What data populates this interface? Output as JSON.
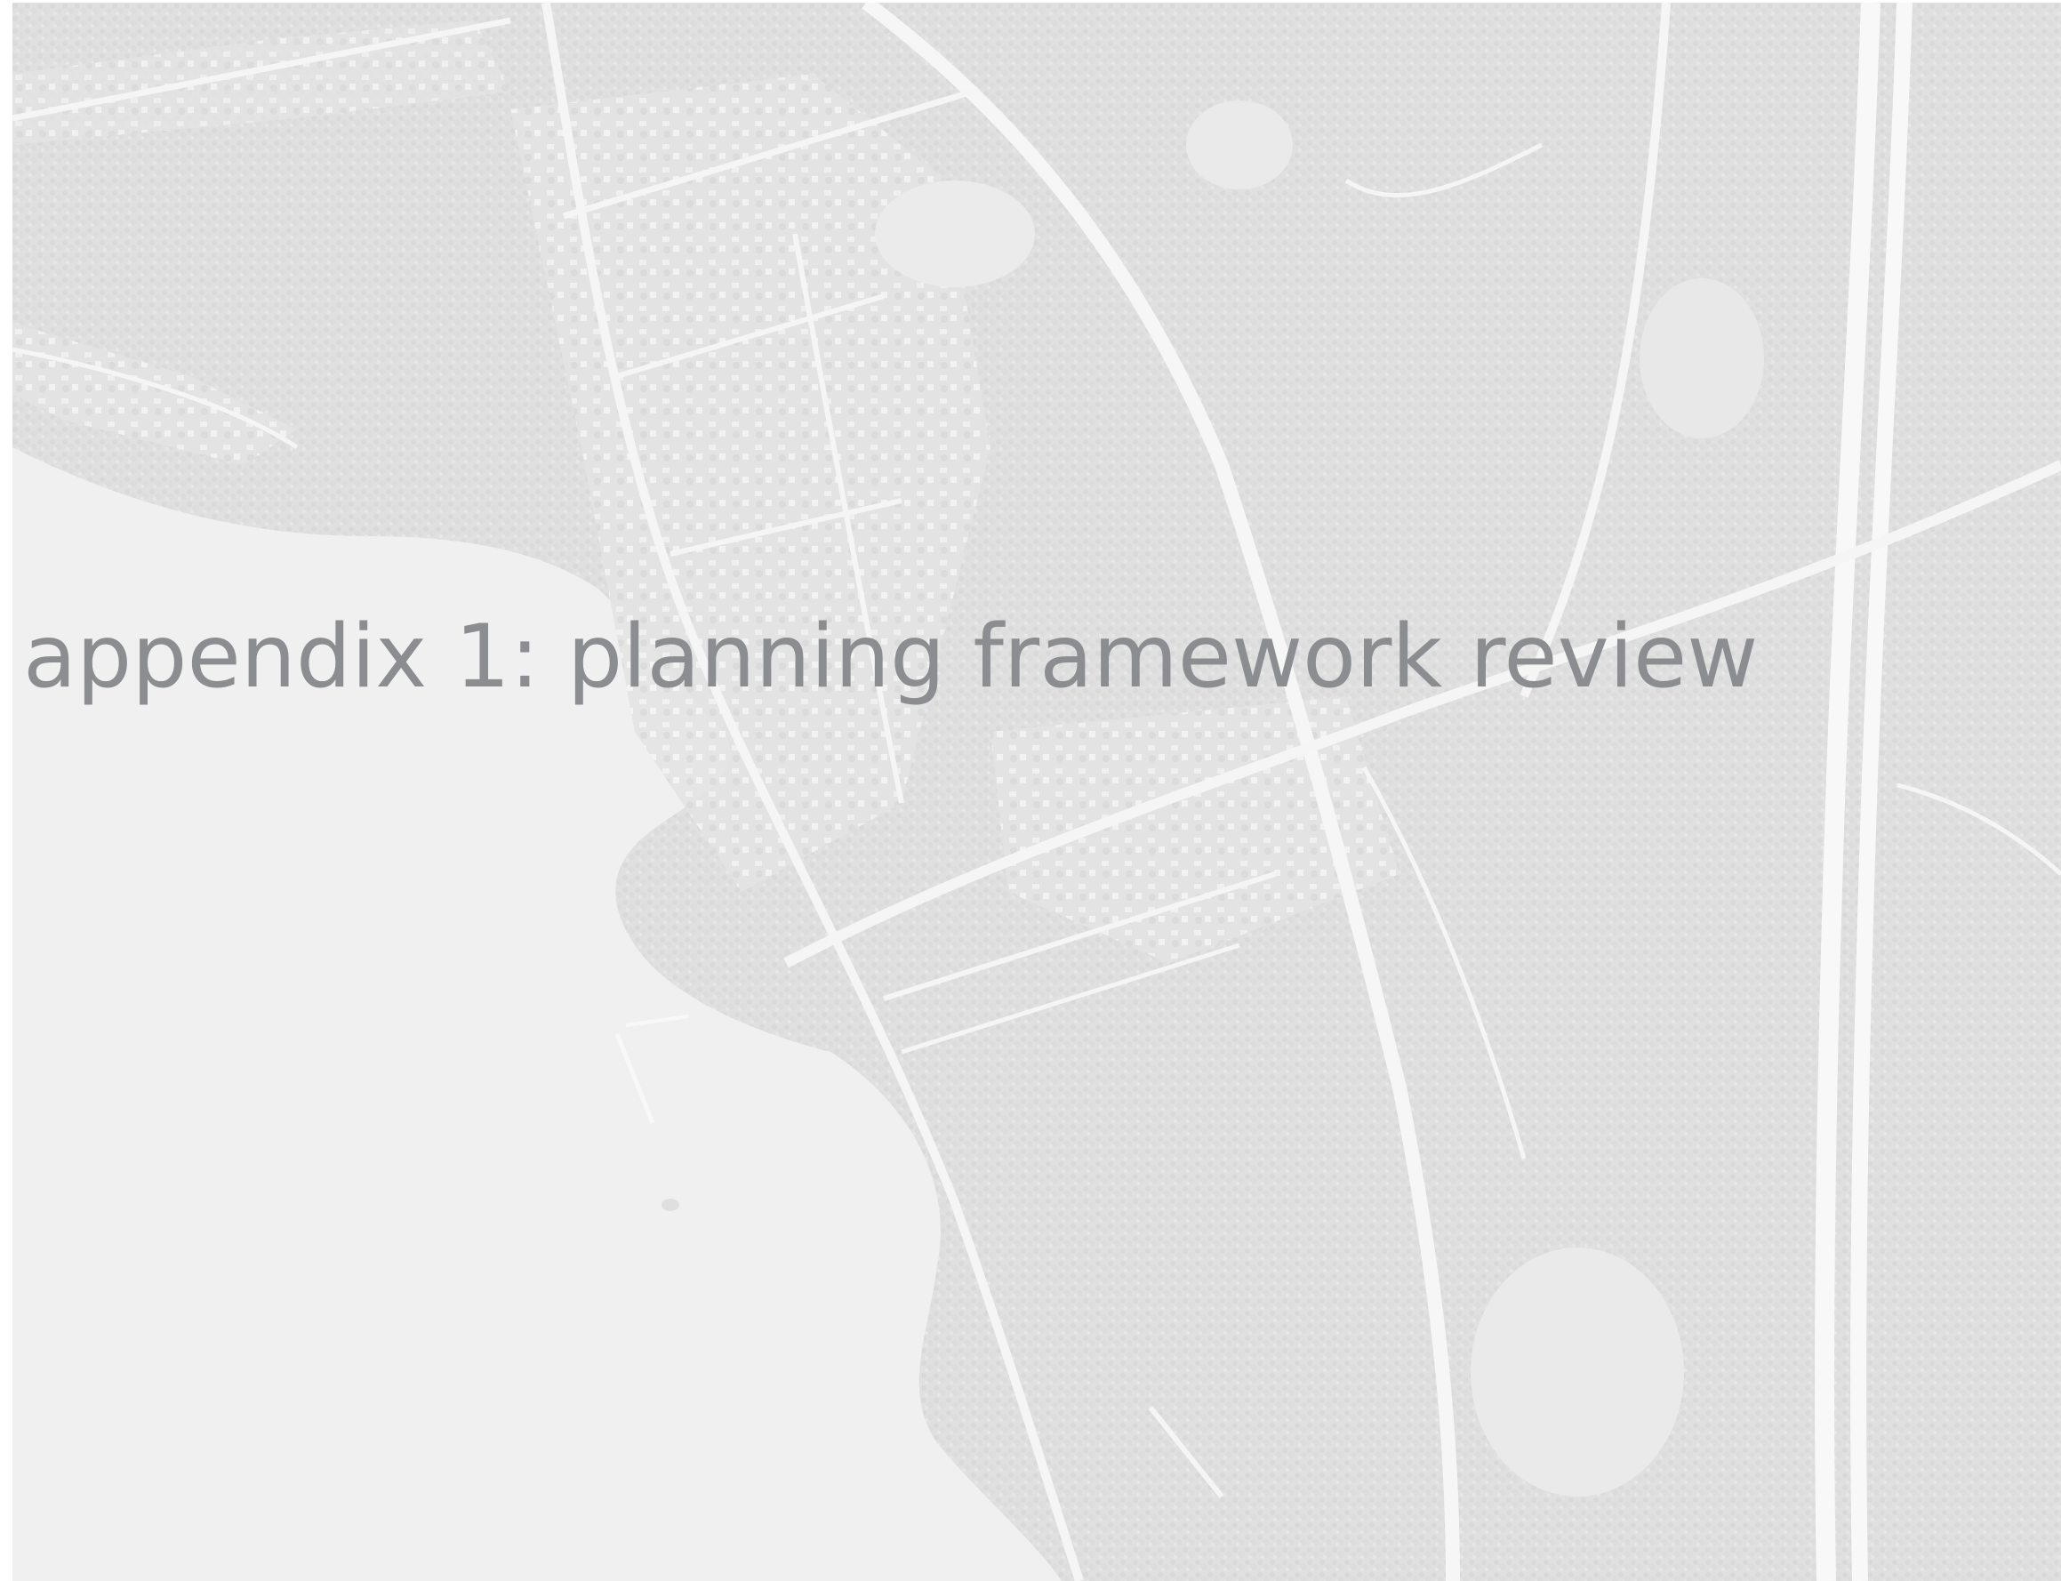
{
  "page": {
    "title": "appendix 1: planning framework review"
  },
  "background": {
    "kind": "aerial map (faded)",
    "colors": {
      "water": "#ececec",
      "land": "#d9d9d9",
      "roads": "#f4f4f4",
      "title_text": "#8c8d91"
    }
  }
}
